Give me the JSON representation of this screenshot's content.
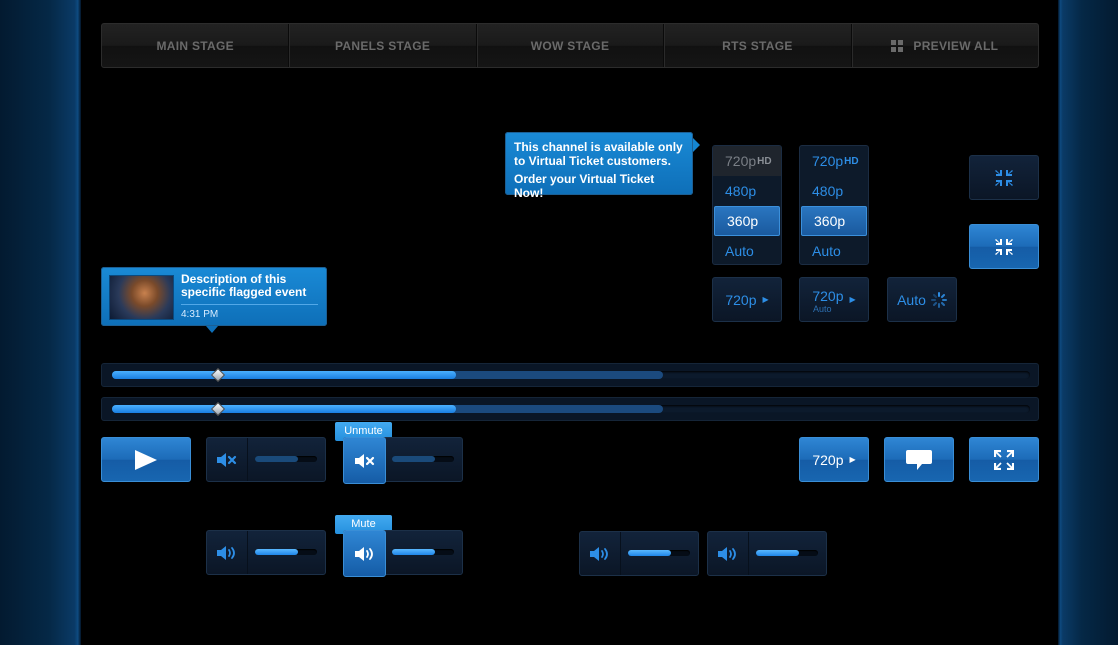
{
  "nav": {
    "main": "MAIN STAGE",
    "panels": "PANELS STAGE",
    "wow": "WOW STAGE",
    "rts": "RTS STAGE",
    "preview": "PREVIEW ALL",
    "preview_icon": "grid-icon"
  },
  "channel_tooltip": {
    "line1": "This channel is available only to Virtual Ticket customers.",
    "line2": "Order your Virtual Ticket Now!"
  },
  "event_tooltip": {
    "title": "Description of this specific flagged event",
    "time": "4:31 PM"
  },
  "quality_menu_a": {
    "items": [
      {
        "res": "720p",
        "hd": "HD"
      },
      {
        "res": "480p"
      },
      {
        "res": "360p"
      },
      {
        "res": "Auto"
      }
    ],
    "selected": "360p"
  },
  "quality_menu_b": {
    "items": [
      {
        "res": "720p",
        "hd": "HD"
      },
      {
        "res": "480p"
      },
      {
        "res": "360p"
      },
      {
        "res": "Auto"
      }
    ],
    "selected": "360p"
  },
  "quality_buttons": {
    "q1": "720p",
    "q2": "720p",
    "q2_sub": "Auto",
    "q3": "Auto",
    "q4": "720p"
  },
  "progress": {
    "played": 0.375,
    "buffered": 0.6,
    "handle": 0.11
  },
  "volume": {
    "muted_tip": "Unmute",
    "unmuted_tip": "Mute",
    "levels": [
      0.7,
      0.7,
      0.7,
      0.7,
      0.7,
      0.7
    ]
  },
  "icons": {
    "play": "play-icon",
    "mute": "speaker-muted-icon",
    "speaker": "speaker-icon",
    "chat": "chat-bubble-icon",
    "fullscreen": "fullscreen-icon",
    "exit_fullscreen": "exit-fullscreen-icon",
    "loading": "loading-spinner-icon"
  },
  "colors": {
    "accent": "#1f86e8",
    "button_blue": "#1c6bb8",
    "tooltip_blue": "#0e6fb8"
  }
}
